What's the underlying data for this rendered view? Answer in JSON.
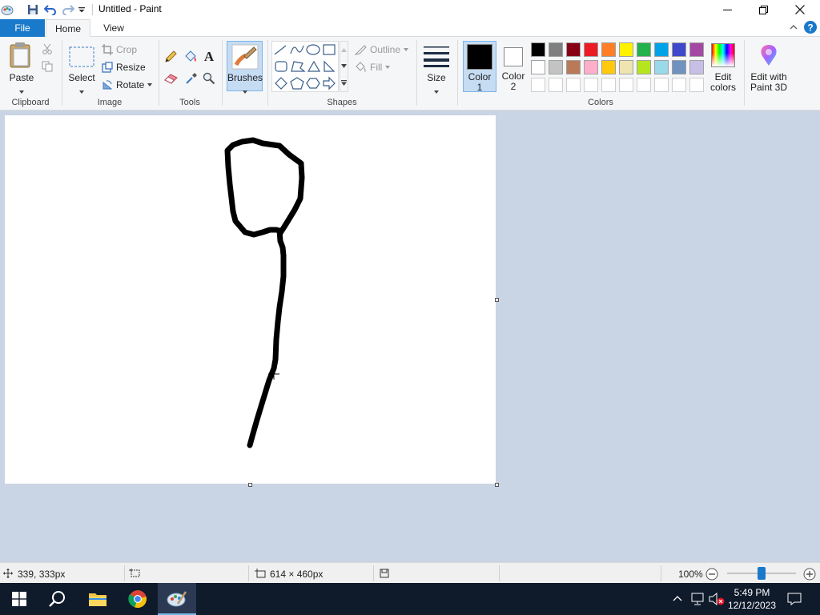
{
  "window": {
    "title": "Untitled - Paint"
  },
  "tabs": {
    "file": "File",
    "home": "Home",
    "view": "View"
  },
  "clipboard": {
    "paste": "Paste",
    "group": "Clipboard"
  },
  "image": {
    "select": "Select",
    "crop": "Crop",
    "resize": "Resize",
    "rotate": "Rotate",
    "group": "Image"
  },
  "tools": {
    "group": "Tools"
  },
  "brushes": {
    "label": "Brushes"
  },
  "shapes": {
    "outline": "Outline",
    "fill": "Fill",
    "group": "Shapes"
  },
  "size": {
    "label": "Size"
  },
  "colors": {
    "color1_line1": "Color",
    "color1_line2": "1",
    "color2_line1": "Color",
    "color2_line2": "2",
    "edit_line1": "Edit",
    "edit_line2": "colors",
    "group": "Colors",
    "color1_value": "#000000",
    "color2_value": "#ffffff",
    "palette": [
      "#000000",
      "#7f7f7f",
      "#880015",
      "#ed1c24",
      "#ff7f27",
      "#fff200",
      "#22b14c",
      "#00a2e8",
      "#3f48cc",
      "#a349a4",
      "#ffffff",
      "#c3c3c3",
      "#b97a57",
      "#ffaec9",
      "#ffc90e",
      "#efe4b0",
      "#b5e61d",
      "#99d9ea",
      "#7092be",
      "#c8bfe7"
    ]
  },
  "paint3d": {
    "line1": "Edit with",
    "line2": "Paint 3D"
  },
  "status": {
    "cursor": "339, 333px",
    "canvas_size": "614 × 460px",
    "zoom": "100%",
    "zoom_fraction": 0.5
  },
  "taskbar": {
    "time": "5:49 PM",
    "date": "12/12/2023"
  }
}
